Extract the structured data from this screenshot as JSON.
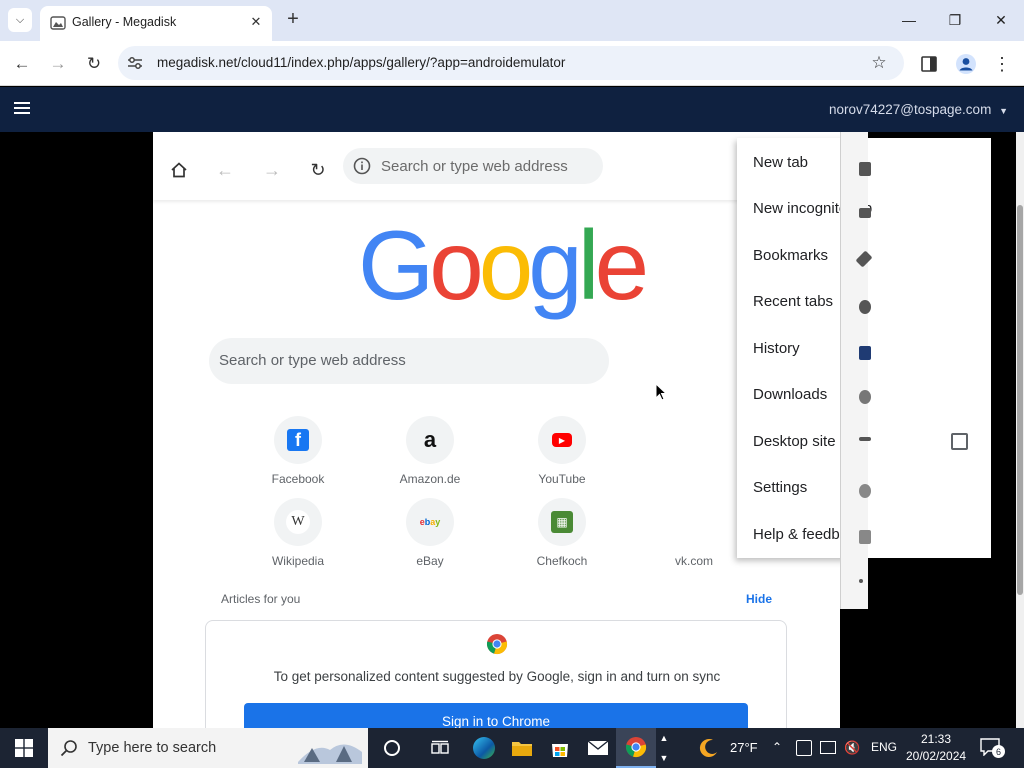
{
  "browser": {
    "tab_title": "Gallery - Megadisk",
    "url": "megadisk.net/cloud11/index.php/apps/gallery/?app=androidemulator"
  },
  "app": {
    "user_email": "norov74227@tospage.com"
  },
  "emulator": {
    "omnibox_placeholder": "Search or type web address",
    "logo_text": "Google",
    "search_placeholder": "Search or type web address",
    "tiles": [
      {
        "label": "Facebook",
        "icon": "facebook-icon"
      },
      {
        "label": "Amazon.de",
        "icon": "amazon-icon"
      },
      {
        "label": "YouTube",
        "icon": "youtube-icon"
      },
      {
        "label": "Wikipedia",
        "icon": "wikipedia-icon"
      },
      {
        "label": "eBay",
        "icon": "ebay-icon"
      },
      {
        "label": "Chefkoch",
        "icon": "chefkoch-icon"
      },
      {
        "label": "vk.com",
        "icon": "vk-icon"
      }
    ],
    "articles_label": "Articles for you",
    "hide_label": "Hide",
    "sync_text": "To get personalized content suggested by Google, sign in and turn on sync",
    "sync_button": "Sign in to Chrome",
    "menu": {
      "items": [
        "New tab",
        "New incognito tab",
        "Bookmarks",
        "Recent tabs",
        "History",
        "Downloads",
        "Desktop site",
        "Settings",
        "Help & feedback"
      ],
      "desktop_site_checked": false
    }
  },
  "taskbar": {
    "search_placeholder": "Type here to search",
    "temperature": "27°F",
    "language": "ENG",
    "time": "21:33",
    "date": "20/02/2024",
    "notification_count": "6"
  },
  "colors": {
    "app_header": "#0f2140",
    "accent": "#1a73e8",
    "taskbar": "#1c2433"
  }
}
